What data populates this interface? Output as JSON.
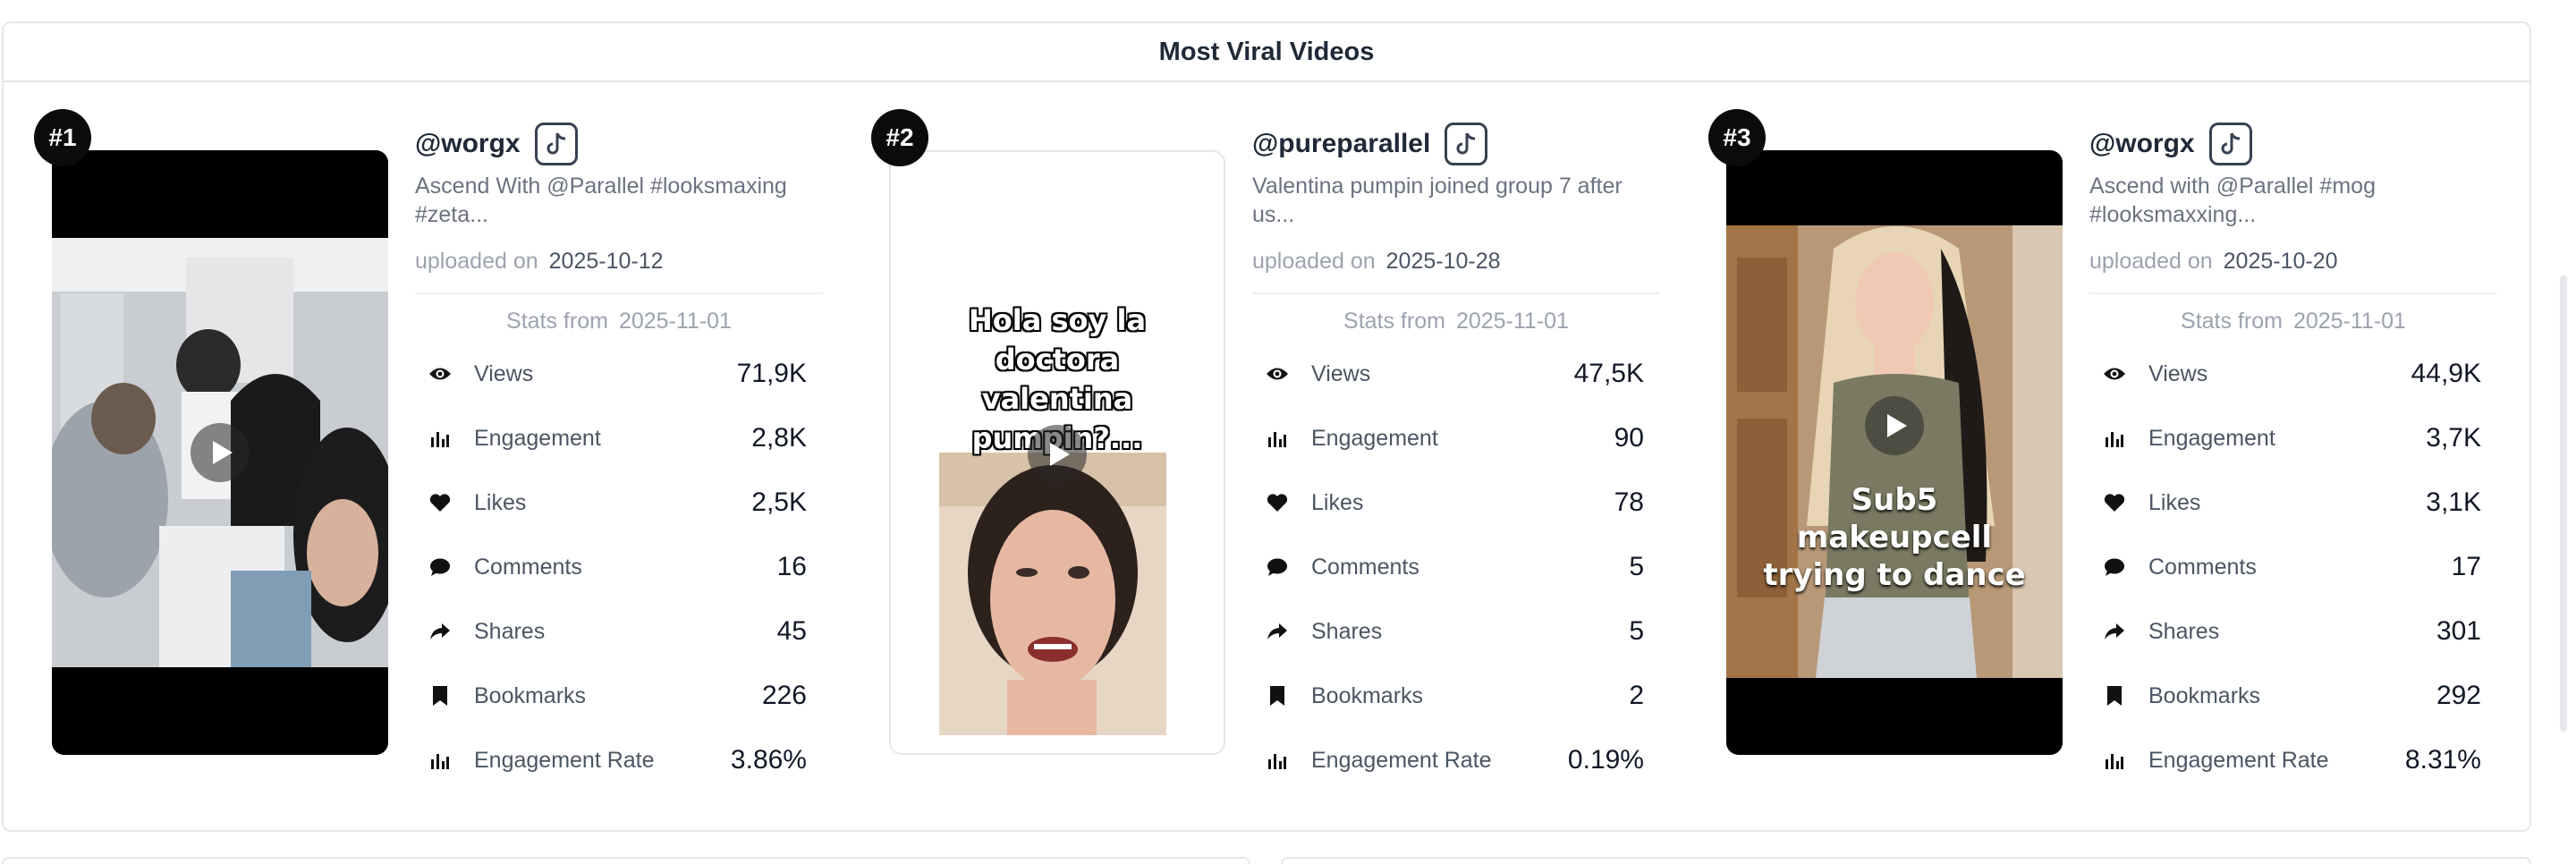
{
  "panel": {
    "title": "Most Viral Videos"
  },
  "labels": {
    "uploaded_on": "uploaded on",
    "stats_from": "Stats from"
  },
  "videos": [
    {
      "rank": "#1",
      "username": "@worgx",
      "platform_icon": "tiktok-icon",
      "caption": "Ascend With @Parallel #looksmaxing #zeta...",
      "uploaded_date": "2025-10-12",
      "stats_date": "2025-11-01",
      "overlay_text": "",
      "stats": [
        {
          "icon": "eye-icon",
          "label": "Views",
          "value": "71,9K"
        },
        {
          "icon": "bar-chart-icon",
          "label": "Engagement",
          "value": "2,8K"
        },
        {
          "icon": "heart-icon",
          "label": "Likes",
          "value": "2,5K"
        },
        {
          "icon": "comment-icon",
          "label": "Comments",
          "value": "16"
        },
        {
          "icon": "share-icon",
          "label": "Shares",
          "value": "45"
        },
        {
          "icon": "bookmark-icon",
          "label": "Bookmarks",
          "value": "226"
        },
        {
          "icon": "bar-chart-icon",
          "label": "Engagement Rate",
          "value": "3.86%"
        }
      ]
    },
    {
      "rank": "#2",
      "username": "@pureparallel",
      "platform_icon": "tiktok-icon",
      "caption": "Valentina pumpin joined group 7 after us...",
      "uploaded_date": "2025-10-28",
      "stats_date": "2025-11-01",
      "overlay_text": "Hola soy la doctora valentina pumpin?...",
      "stats": [
        {
          "icon": "eye-icon",
          "label": "Views",
          "value": "47,5K"
        },
        {
          "icon": "bar-chart-icon",
          "label": "Engagement",
          "value": "90"
        },
        {
          "icon": "heart-icon",
          "label": "Likes",
          "value": "78"
        },
        {
          "icon": "comment-icon",
          "label": "Comments",
          "value": "5"
        },
        {
          "icon": "share-icon",
          "label": "Shares",
          "value": "5"
        },
        {
          "icon": "bookmark-icon",
          "label": "Bookmarks",
          "value": "2"
        },
        {
          "icon": "bar-chart-icon",
          "label": "Engagement Rate",
          "value": "0.19%"
        }
      ]
    },
    {
      "rank": "#3",
      "username": "@worgx",
      "platform_icon": "tiktok-icon",
      "caption": "Ascend with @Parallel #mog #looksmaxxing...",
      "uploaded_date": "2025-10-20",
      "stats_date": "2025-11-01",
      "overlay_text": "Sub5 makeupcell trying to dance",
      "stats": [
        {
          "icon": "eye-icon",
          "label": "Views",
          "value": "44,9K"
        },
        {
          "icon": "bar-chart-icon",
          "label": "Engagement",
          "value": "3,7K"
        },
        {
          "icon": "heart-icon",
          "label": "Likes",
          "value": "3,1K"
        },
        {
          "icon": "comment-icon",
          "label": "Comments",
          "value": "17"
        },
        {
          "icon": "share-icon",
          "label": "Shares",
          "value": "301"
        },
        {
          "icon": "bookmark-icon",
          "label": "Bookmarks",
          "value": "292"
        },
        {
          "icon": "bar-chart-icon",
          "label": "Engagement Rate",
          "value": "8.31%"
        }
      ]
    }
  ]
}
